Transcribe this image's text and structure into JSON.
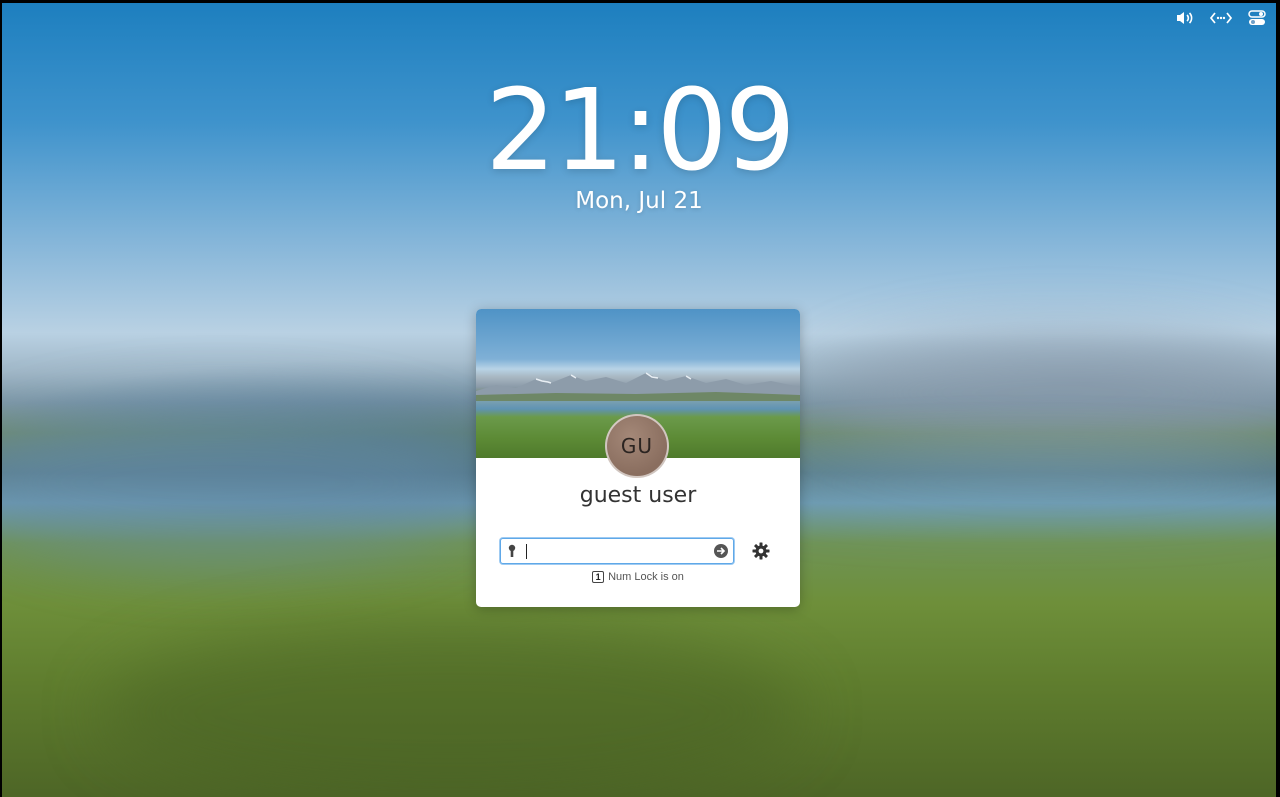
{
  "status_bar": {
    "icons": [
      "volume-icon",
      "network-icon",
      "settings-toggle-icon"
    ]
  },
  "lock_screen": {
    "time": "21:09",
    "date": "Mon, Jul 21"
  },
  "login_card": {
    "avatar_initials": "GU",
    "username": "guest user",
    "password_field": {
      "value": "",
      "placeholder": ""
    },
    "numlock_icon_glyph": "1",
    "numlock_text": "Num Lock is on"
  },
  "colors": {
    "accent": "#5fa8e8",
    "avatar": "#8a6e5f"
  }
}
